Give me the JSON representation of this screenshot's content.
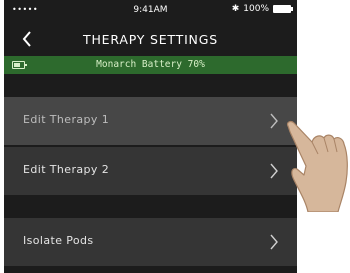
{
  "status_bar": {
    "signal": "•••••",
    "time": "9:41AM",
    "bluetooth_glyph": "✱",
    "battery": "100%"
  },
  "header": {
    "title": "THERAPY SETTINGS",
    "back_icon": "chevron-left-icon"
  },
  "banner": {
    "text": "Monarch Battery 70%",
    "icon": "battery-icon",
    "color": "#2d6a2d"
  },
  "menu": {
    "items": [
      {
        "label": "Edit Therapy 1",
        "icon": "chevron-right-icon",
        "highlighted": true
      },
      {
        "label": "Edit Therapy 2",
        "icon": "chevron-right-icon",
        "highlighted": false
      },
      {
        "label": "Isolate Pods",
        "icon": "chevron-right-icon",
        "highlighted": false
      }
    ]
  },
  "colors": {
    "background": "#1c1c1c",
    "row": "#353535",
    "row_highlight": "#474747",
    "text": "#e4e4e4"
  }
}
